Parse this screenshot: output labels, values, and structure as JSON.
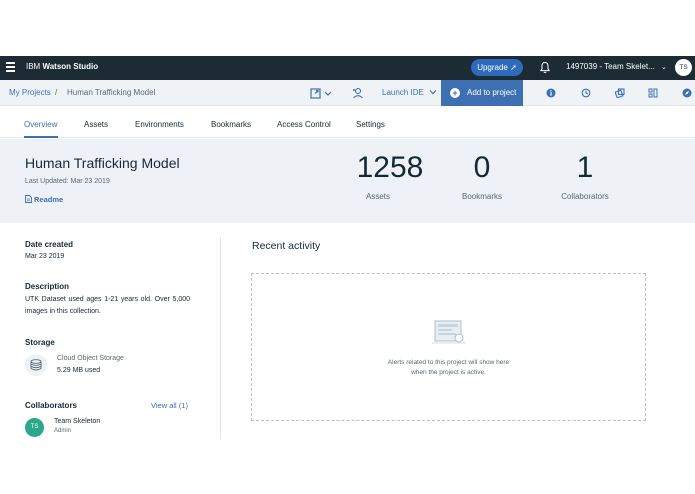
{
  "topbar": {
    "brand_prefix": "IBM",
    "brand_name": "Watson Studio",
    "upgrade_label": "Upgrade",
    "account_label": "1497039 - Team Skelet...",
    "avatar_initials": "TS"
  },
  "breadcrumb": {
    "parent": "My Projects",
    "separator": "/",
    "current": "Human Trafficking Model"
  },
  "toolbar": {
    "launch_ide_label": "Launch IDE",
    "add_to_project_label": "Add to project",
    "icons": [
      "new-asset-icon",
      "collaborator-icon",
      "info-icon",
      "history-icon",
      "gallery-icon",
      "data-icon",
      "compass-icon"
    ]
  },
  "tabs": [
    {
      "label": "Overview",
      "active": true
    },
    {
      "label": "Assets"
    },
    {
      "label": "Environments"
    },
    {
      "label": "Bookmarks"
    },
    {
      "label": "Access Control"
    },
    {
      "label": "Settings"
    }
  ],
  "project": {
    "title": "Human Trafficking Model",
    "last_updated": "Last Updated: Mar 23 2019",
    "readme_label": "Readme"
  },
  "stats": [
    {
      "value": "1258",
      "label": "Assets"
    },
    {
      "value": "0",
      "label": "Bookmarks"
    },
    {
      "value": "1",
      "label": "Collaborators"
    }
  ],
  "details": {
    "date_created_heading": "Date created",
    "date_created": "Mar 23 2019",
    "description_heading": "Description",
    "description": "UTK Dataset used ages 1-21 years old. Over 5,000 images in this collection.",
    "storage_heading": "Storage",
    "storage_type": "Cloud Object Storage",
    "storage_used": "5.29 MB used",
    "collaborators_heading": "Collaborators",
    "view_all_label": "View all (1)",
    "collaborator_initials": "TS",
    "collaborator_name": "Team Skeleton",
    "collaborator_role": "Admin"
  },
  "activity": {
    "heading": "Recent activity",
    "empty_line1": "Alerts related to this project will show here",
    "empty_line2": "when the project is active."
  },
  "colors": {
    "topbar": "#1d2b34",
    "accent": "#3d70b2",
    "upgrade": "#2f6bbd",
    "collaborator_avatar": "#2aa889"
  }
}
